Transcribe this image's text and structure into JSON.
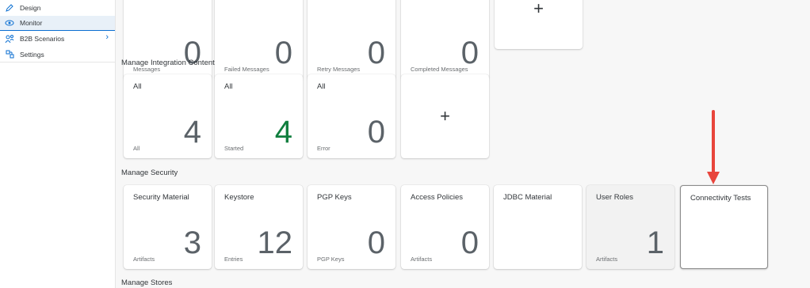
{
  "sidebar": {
    "items": [
      {
        "label": "Design",
        "icon": "pencil-icon"
      },
      {
        "label": "Monitor",
        "icon": "eye-icon"
      },
      {
        "label": "B2B Scenarios",
        "icon": "group-icon"
      },
      {
        "label": "Settings",
        "icon": "settings-icon"
      }
    ]
  },
  "message_tiles": [
    {
      "value": "0",
      "foot": "Messages"
    },
    {
      "value": "0",
      "foot": "Failed Messages"
    },
    {
      "value": "0",
      "foot": "Retry Messages"
    },
    {
      "value": "0",
      "foot": "Completed Messages"
    },
    {
      "plus": "+"
    }
  ],
  "integration": {
    "title": "Manage Integration Content",
    "tiles": [
      {
        "title": "All",
        "value": "4",
        "foot": "All"
      },
      {
        "title": "All",
        "value": "4",
        "foot": "Started"
      },
      {
        "title": "All",
        "value": "0",
        "foot": "Error"
      },
      {
        "plus": "+"
      }
    ]
  },
  "security": {
    "title": "Manage Security",
    "tiles": [
      {
        "title": "Security Material",
        "value": "3",
        "foot": "Artifacts"
      },
      {
        "title": "Keystore",
        "value": "12",
        "foot": "Entries"
      },
      {
        "title": "PGP Keys",
        "value": "0",
        "foot": "PGP Keys"
      },
      {
        "title": "Access Policies",
        "value": "0",
        "foot": "Artifacts"
      },
      {
        "title": "JDBC Material"
      },
      {
        "title": "User Roles",
        "value": "1",
        "foot": "Artifacts"
      },
      {
        "title": "Connectivity Tests"
      }
    ]
  },
  "stores": {
    "title": "Manage Stores"
  },
  "colors": {
    "accent": "#0a6ed1",
    "started_green": "#107e3e",
    "arrow_red": "#e8453c"
  }
}
